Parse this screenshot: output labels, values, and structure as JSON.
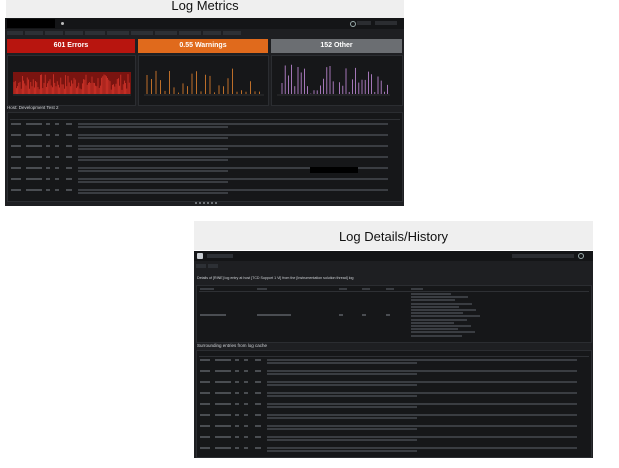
{
  "captions": {
    "top": "Log Metrics",
    "bottom": "Log Details/History"
  },
  "metrics": {
    "stats": [
      {
        "label": "601 Errors",
        "color": "#b8150f"
      },
      {
        "label": "0.55 Warnings",
        "color": "#e06a1c"
      },
      {
        "label": "152 Other",
        "color": "#6b6e72"
      }
    ],
    "section_title": "Host: Development Test 2"
  },
  "details": {
    "header_line": "Details of [RINE] log entry at host [TCD Support 1 Vi] from the [Instrumentation solution thread] log",
    "section_title": "Surrounding entries from log cache"
  },
  "colors": {
    "background": "#1e1f22",
    "panel": "#161719",
    "error": "#b8150f",
    "warning": "#e06a1c",
    "other": "#6b6e72"
  }
}
